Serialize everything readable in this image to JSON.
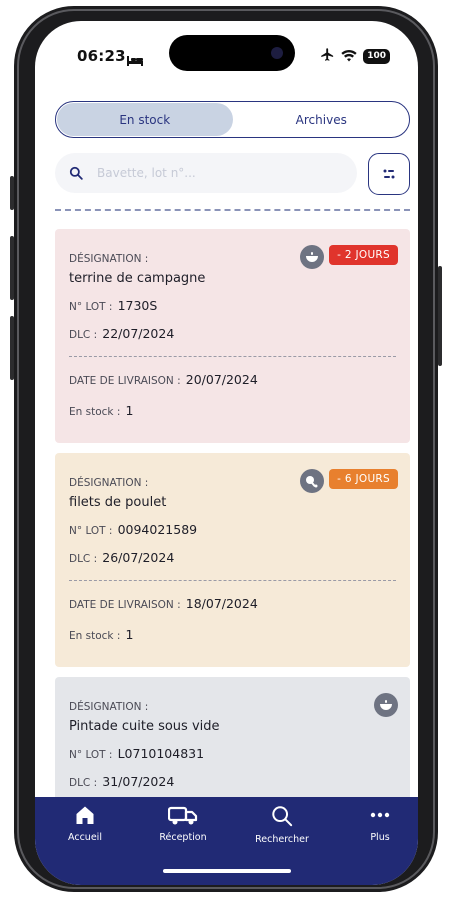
{
  "status_bar": {
    "time": "06:23",
    "battery": "100"
  },
  "tabs": [
    {
      "label": "En stock",
      "active": true
    },
    {
      "label": "Archives",
      "active": false
    }
  ],
  "search": {
    "placeholder": "Bavette, lot n°..."
  },
  "cards": [
    {
      "designation_label": "DÉSIGNATION :",
      "name": "terrine de campagne",
      "lot_label": "N° LOT :",
      "lot": "1730S",
      "dlc_label": "DLC :",
      "dlc": "22/07/2024",
      "delivery_label": "DATE DE LIVRAISON :",
      "delivery": "20/07/2024",
      "stock_label": "En stock :",
      "stock": "1",
      "badge": "- 2 JOURS",
      "badge_color": "#e0342c",
      "type_icon": "bowl-icon",
      "background": "#f5e5e6"
    },
    {
      "designation_label": "DÉSIGNATION :",
      "name": "filets de poulet",
      "lot_label": "N° LOT :",
      "lot": "0094021589",
      "dlc_label": "DLC :",
      "dlc": "26/07/2024",
      "delivery_label": "DATE DE LIVRAISON :",
      "delivery": "18/07/2024",
      "stock_label": "En stock :",
      "stock": "1",
      "badge": "- 6 JOURS",
      "badge_color": "#e8802e",
      "type_icon": "chicken-icon",
      "background": "#f6ead8"
    },
    {
      "designation_label": "DÉSIGNATION :",
      "name": "Pintade cuite sous vide",
      "lot_label": "N° LOT :",
      "lot": "L0710104831",
      "dlc_label": "DLC :",
      "dlc": "31/07/2024",
      "type_icon": "bowl-icon",
      "background": "#e4e6ea"
    }
  ],
  "nav": [
    {
      "label": "Accueil",
      "icon": "home-icon"
    },
    {
      "label": "Réception",
      "icon": "truck-icon"
    },
    {
      "label": "Rechercher",
      "icon": "search-icon"
    },
    {
      "label": "Plus",
      "icon": "more-icon"
    }
  ],
  "colors": {
    "primary": "#212a75",
    "accent_light": "#c9d3e3"
  }
}
